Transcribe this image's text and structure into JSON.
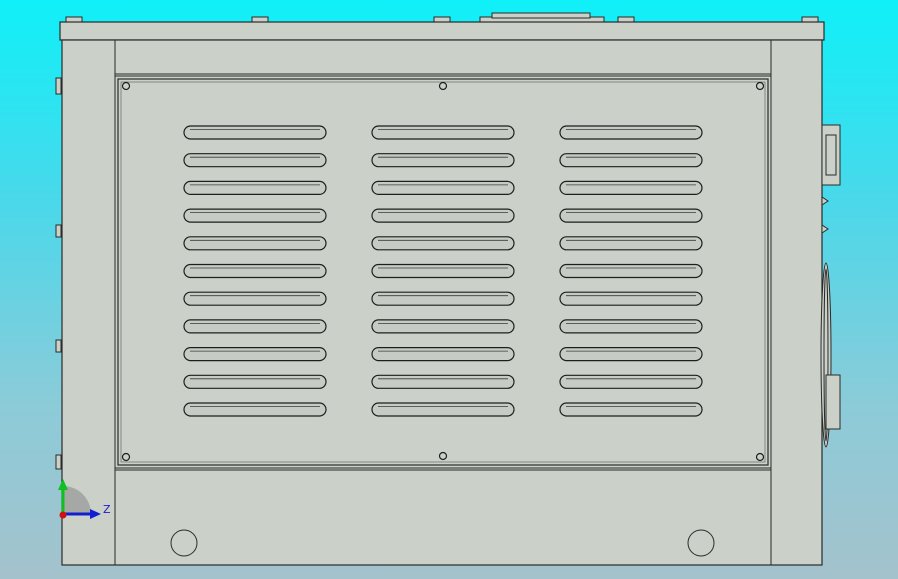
{
  "viewport": {
    "background_top": "#0ff0f8",
    "background_bottom": "#a4c2cc",
    "model_fill": "#cbd1c8",
    "edge_color": "#2a2a2a"
  },
  "model": {
    "name": "enclosure-side-view",
    "louver_columns": 3,
    "louver_rows": 11,
    "panel_screws": 6,
    "bottom_holes": 2
  },
  "triad": {
    "axis_z_label": "Z",
    "x_color": "#d01010",
    "y_color": "#10c020",
    "z_color": "#1020d0"
  }
}
